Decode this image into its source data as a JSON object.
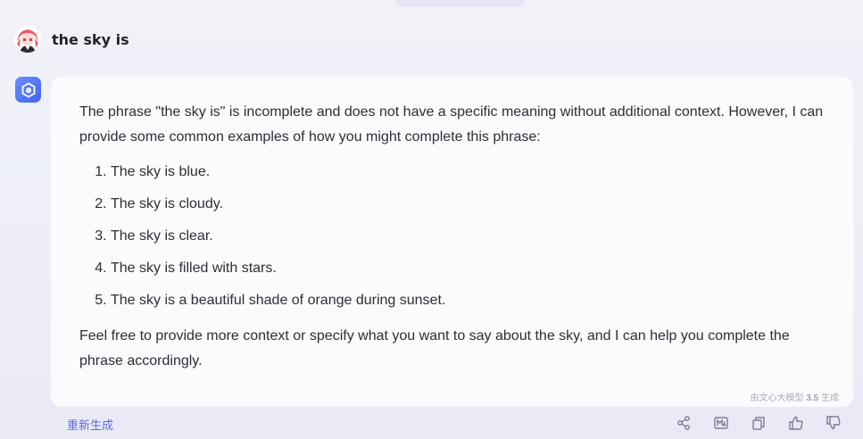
{
  "user_message": "the sky is",
  "response": {
    "intro": "The phrase \"the sky is\" is incomplete and does not have a specific meaning without additional context. However, I can provide some common examples of how you might complete this phrase:",
    "items": [
      "The sky is blue.",
      "The sky is cloudy.",
      "The sky is clear.",
      "The sky is filled with stars.",
      "The sky is a beautiful shade of orange during sunset."
    ],
    "outro": "Feel free to provide more context or specify what you want to say about the sky, and I can help you complete the phrase accordingly.",
    "generated_by_prefix": "由文心大模型",
    "generated_by_version": "3.5",
    "generated_by_suffix": "生成"
  },
  "footer": {
    "regenerate_label": "重新生成",
    "actions": [
      "share-icon",
      "markdown-icon",
      "copy-icon",
      "thumbs-up-icon",
      "thumbs-down-icon"
    ]
  },
  "colors": {
    "accent": "#5c6bd8",
    "logo": "#4a6cf7",
    "icon": "#7a7f8c"
  }
}
